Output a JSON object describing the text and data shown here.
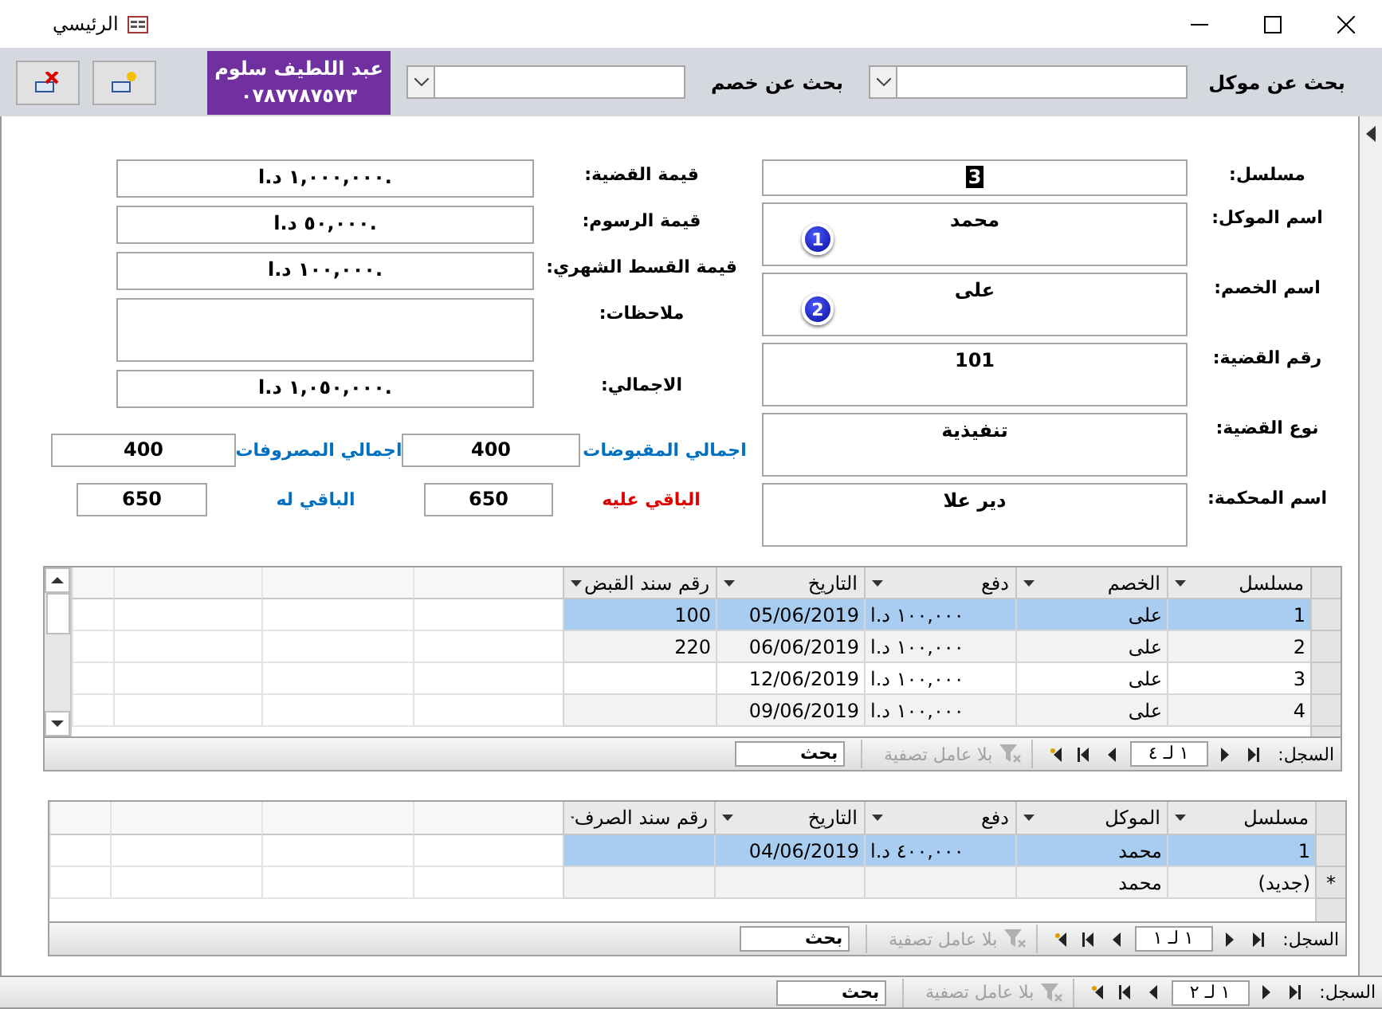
{
  "window": {
    "title": "الرئيسي"
  },
  "toolbar": {
    "contact": {
      "name": "عبد اللطيف سلوم",
      "phone": "٠٧٨٧٧٨٧٥٧٣"
    },
    "searches": [
      {
        "label": "بحث عن موكل"
      },
      {
        "label": "بحث عن خصم"
      }
    ]
  },
  "case_fields": [
    {
      "label": "مسلسل:",
      "value": "3",
      "highlighted": true
    },
    {
      "label": "اسم الموكل:",
      "value": "محمد",
      "badge": "1",
      "highlighted": false
    },
    {
      "label": "اسم الخصم:",
      "value": "على",
      "badge": "2",
      "highlighted": false
    },
    {
      "label": "رقم القضية:",
      "value": "101",
      "highlighted": false
    },
    {
      "label": "نوع القضية:",
      "value": "تنفيذية",
      "highlighted": false
    },
    {
      "label": "اسم المحكمة:",
      "value": "دير علا",
      "highlighted": false
    }
  ],
  "amount_fields": [
    {
      "label": "قيمة القضية:",
      "value": "١,٠٠٠,٠٠٠ د.ا."
    },
    {
      "label": "قيمة الرسوم:",
      "value": "٥٠,٠٠٠ د.ا."
    },
    {
      "label": "قيمة القسط الشهري:",
      "value": "١٠٠,٠٠٠ د.ا."
    },
    {
      "label": "ملاحظات:"
    },
    {
      "label": "الاجمالي:",
      "value": "١,٠٥٠,٠٠٠ د.ا."
    }
  ],
  "totals": [
    {
      "label": "اجمالي المقبوضات",
      "value": "400",
      "color": "#0070c0"
    },
    {
      "label": "اجمالي المصروفات",
      "value": "400",
      "color": "#0070c0"
    },
    {
      "label": "الباقي عليه",
      "value": "650",
      "color": "#e00000"
    },
    {
      "label": "الباقي له",
      "value": "650",
      "color": "#0070c0"
    }
  ],
  "receipts": {
    "columns": [
      "مسلسل",
      "الخصم",
      "دفع",
      "التاريخ",
      "رقم سند القبض"
    ],
    "rows": [
      {
        "serial": "1",
        "party": "على",
        "payment": "١٠٠,٠٠٠ د.ا",
        "date": "05/06/2019",
        "voucher": "100",
        "selected": true
      },
      {
        "serial": "2",
        "party": "على",
        "payment": "١٠٠,٠٠٠ د.ا",
        "date": "06/06/2019",
        "voucher": "220",
        "selected": false
      },
      {
        "serial": "3",
        "party": "على",
        "payment": "١٠٠,٠٠٠ د.ا",
        "date": "12/06/2019",
        "selected": false
      },
      {
        "serial": "4",
        "party": "على",
        "payment": "١٠٠,٠٠٠ د.ا",
        "date": "09/06/2019",
        "selected": false
      }
    ],
    "nav": {
      "label": "السجل:",
      "position": "١ لـ ٤",
      "filter": "بلا عامل تصفية",
      "search": "بحث"
    }
  },
  "expenses": {
    "columns": [
      "مسلسل",
      "الموكل",
      "دفع",
      "التاريخ",
      "رقم سند الصرف"
    ],
    "rows": [
      {
        "serial": "1",
        "party": "محمد",
        "payment": "٤٠٠,٠٠٠ د.ا",
        "date": "04/06/2019",
        "selected": true
      },
      {
        "serial": "(جديد)",
        "party": "محمد",
        "marker": "*",
        "selected": false
      }
    ],
    "nav": {
      "label": "السجل:",
      "position": "١ لـ ١",
      "filter": "بلا عامل تصفية",
      "search": "بحث"
    }
  },
  "record_nav": {
    "label": "السجل:",
    "position": "١ لـ ٢",
    "filter": "بلا عامل تصفية",
    "search": "بحث"
  }
}
